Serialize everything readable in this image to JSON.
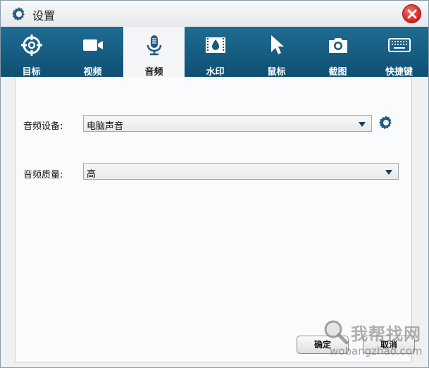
{
  "window": {
    "title": "设置",
    "title_icon": "gear-icon",
    "close_icon": "close-icon"
  },
  "tabs": [
    {
      "label": "目标",
      "icon": "target-icon",
      "active": false
    },
    {
      "label": "视频",
      "icon": "video-camera-icon",
      "active": false
    },
    {
      "label": "音频",
      "icon": "microphone-icon",
      "active": true
    },
    {
      "label": "水印",
      "icon": "film-droplet-icon",
      "active": false
    },
    {
      "label": "鼠标",
      "icon": "cursor-icon",
      "active": false
    },
    {
      "label": "截图",
      "icon": "camera-icon",
      "active": false
    },
    {
      "label": "快捷键",
      "icon": "keyboard-icon",
      "active": false
    }
  ],
  "audio": {
    "device_label": "音频设备:",
    "device_value": "电脑声音",
    "quality_label": "音频质量:",
    "quality_value": "高"
  },
  "buttons": {
    "ok": "确定",
    "cancel": "取消"
  },
  "watermark": {
    "cn": "我帮找网",
    "en": "wobangzhao.com"
  },
  "colors": {
    "tab_bar": "#155a80",
    "close": "#d6201b",
    "arrow": "#1d3f5e"
  }
}
